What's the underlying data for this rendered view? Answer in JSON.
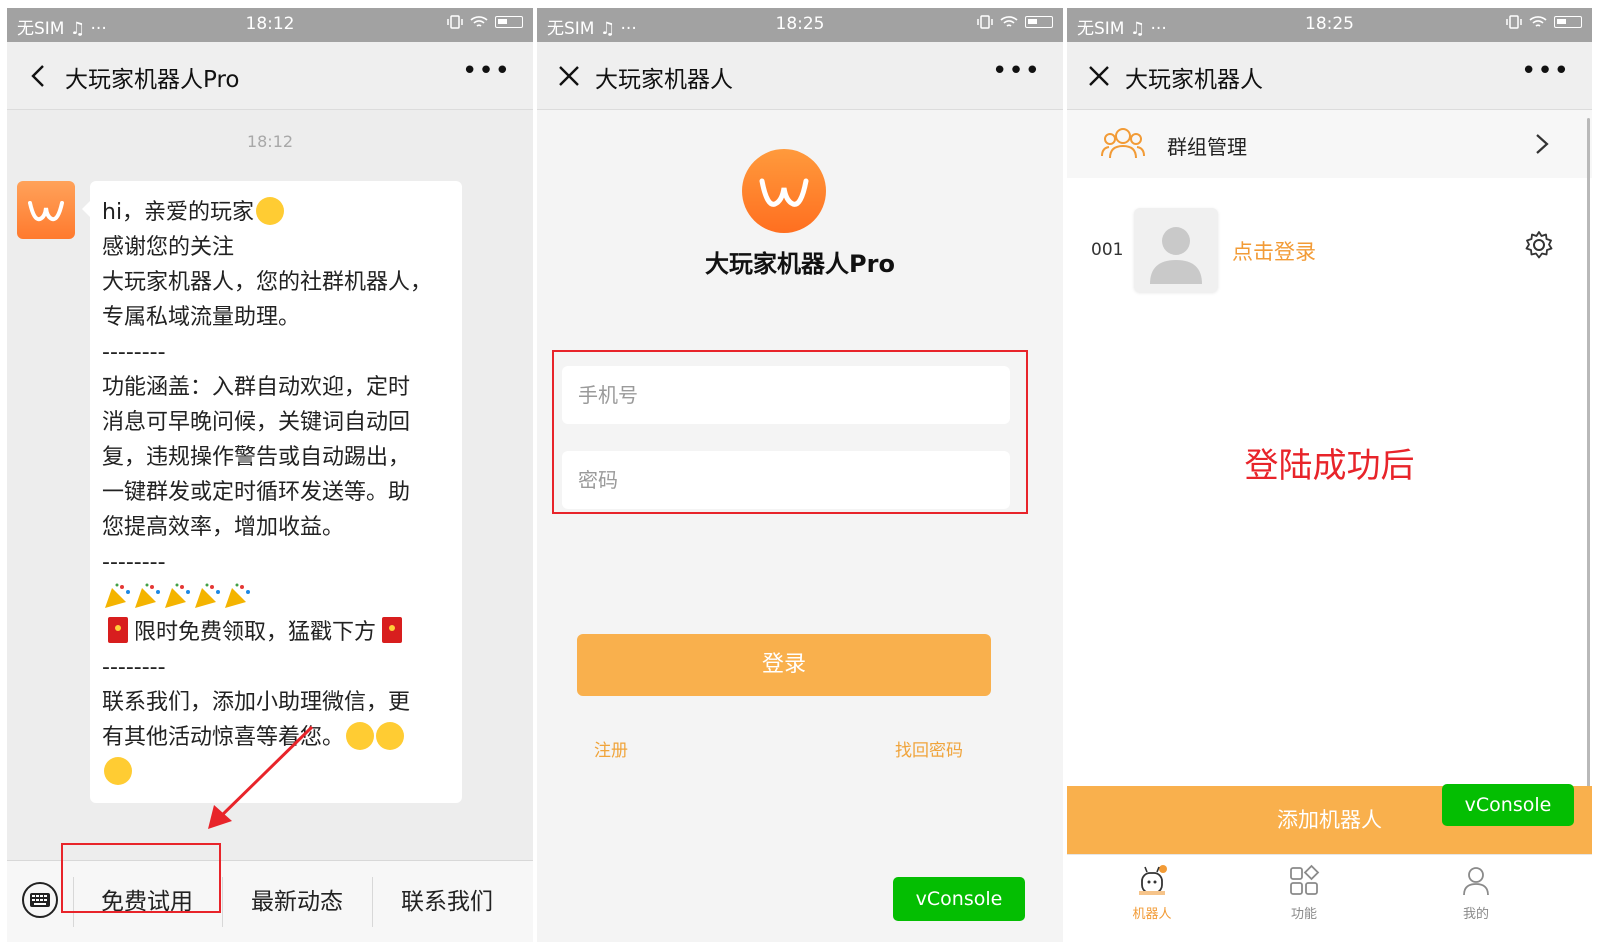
{
  "status_bars": [
    {
      "carrier": "无SIM ♫ ···",
      "time": "18:12"
    },
    {
      "carrier": "无SIM ♫ ···",
      "time": "18:25"
    },
    {
      "carrier": "无SIM ♫ ···",
      "time": "18:25"
    }
  ],
  "panel1": {
    "title": "大玩家机器人Pro",
    "timestamp": "18:12",
    "message": {
      "l1": "hi，亲爱的玩家",
      "l2": "感谢您的关注",
      "l3": "大玩家机器人，您的社群机器人，",
      "l4": "专属私域流量助理。",
      "sep1": "--------",
      "l5": "功能涵盖：入群自动欢迎，定时",
      "l6": "消息可早晚问候，关键词自动回",
      "l7": "复，违规操作警告或自动踢出，",
      "l8": "一键群发或定时循环发送等。助",
      "l9": "您提高效率，增加收益。",
      "sep2": "--------",
      "promo": "限时免费领取，猛戳下方",
      "sep3": "--------",
      "l10": "联系我们，添加小助理微信，更",
      "l11": "有其他活动惊喜等着您。"
    },
    "menu": [
      "免费试用",
      "最新动态",
      "联系我们"
    ]
  },
  "panel2": {
    "title": "大玩家机器人",
    "app_name": "大玩家机器人Pro",
    "phone_placeholder": "手机号",
    "password_placeholder": "密码",
    "login_label": "登录",
    "register_label": "注册",
    "recover_label": "找回密码",
    "vconsole_label": "vConsole"
  },
  "panel3": {
    "title": "大玩家机器人",
    "group_label": "群组管理",
    "bot_index": "001",
    "bot_login": "点击登录",
    "annotation": "登陆成功后",
    "add_robot_label": "添加机器人",
    "vconsole_label": "vConsole",
    "tabs": [
      "机器人",
      "功能",
      "我的"
    ]
  },
  "colors": {
    "accent": "#f9b04d",
    "link": "#f29b36",
    "annotation_red": "#e8242a",
    "vconsole_green": "#04be02"
  }
}
